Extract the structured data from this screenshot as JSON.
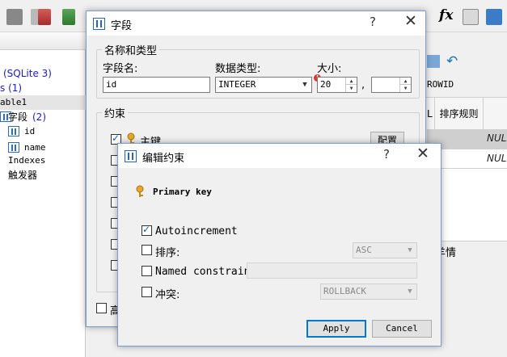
{
  "sidebar": {
    "db_name": "(SQLite 3)",
    "tables_label": "s (1)",
    "table_name": "able1",
    "fields_label": "字段",
    "fields_count": "(2)",
    "fields": [
      "id",
      "name"
    ],
    "indexes_label": "Indexes",
    "triggers_label": "触发器"
  },
  "right_panel": {
    "rowid_label": "ROWID",
    "col_partial": "L",
    "col_sort": "排序规则",
    "null_1": "NULL",
    "null_2": "NULL",
    "details_partial": "羊情"
  },
  "toolbar": {
    "fx_label": "fx"
  },
  "field_dialog": {
    "title": "字段",
    "help": "?",
    "close": "✕",
    "group_name_type": "名称和类型",
    "field_name_label": "字段名:",
    "field_name_value": "id",
    "data_type_label": "数据类型:",
    "data_type_value": "INTEGER",
    "size_label": "大小:",
    "size_value": "20",
    "size_separator": ",",
    "precision_value": "",
    "group_constraints": "约束",
    "primary_key_label": "主键",
    "config_button": "配置",
    "bottom_check_label": "高"
  },
  "constraint_dialog": {
    "title": "编辑约束",
    "help": "?",
    "close": "✕",
    "heading": "Primary key",
    "autoincrement_label": "Autoincrement",
    "autoincrement_checked": true,
    "sort_label": "排序:",
    "sort_value": "ASC",
    "named_constraint_label": "Named constraint:",
    "named_constraint_value": "",
    "conflict_label": "冲突:",
    "conflict_value": "ROLLBACK",
    "apply_label": "Apply",
    "cancel_label": "Cancel"
  },
  "colors": {
    "accent": "#0078d7",
    "link_blue": "#1a1acc",
    "dialog_border": "#7a9cc7",
    "error_badge": "#d9352b"
  }
}
